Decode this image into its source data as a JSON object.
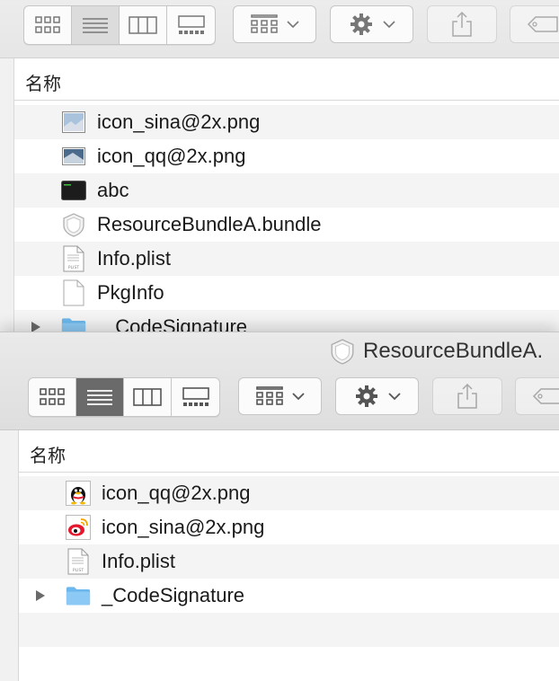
{
  "back_window": {
    "column_name": "名称",
    "files": [
      {
        "name": "icon_sina@2x.png",
        "icon": "image-thumbnail-icon"
      },
      {
        "name": "icon_qq@2x.png",
        "icon": "image-thumbnail-icon"
      },
      {
        "name": "abc",
        "icon": "executable-icon"
      },
      {
        "name": "ResourceBundleA.bundle",
        "icon": "bundle-icon"
      },
      {
        "name": "Info.plist",
        "icon": "plist-file-icon"
      },
      {
        "name": "PkgInfo",
        "icon": "blank-document-icon"
      },
      {
        "name": "_CodeSignature",
        "icon": "folder-icon"
      }
    ]
  },
  "front_window": {
    "title": "ResourceBundleA.",
    "column_name": "名称",
    "files": [
      {
        "name": "icon_qq@2x.png",
        "icon": "qq-penguin-icon"
      },
      {
        "name": "icon_sina@2x.png",
        "icon": "weibo-icon"
      },
      {
        "name": "Info.plist",
        "icon": "plist-file-icon"
      },
      {
        "name": "_CodeSignature",
        "icon": "folder-icon"
      }
    ]
  },
  "colors": {
    "folder_blue": "#6cb8ee",
    "selected_segment_front": "#6a6a6a",
    "row_alt": "#f4f4f4",
    "weibo_red": "#e6162d",
    "qq_black": "#111111"
  }
}
